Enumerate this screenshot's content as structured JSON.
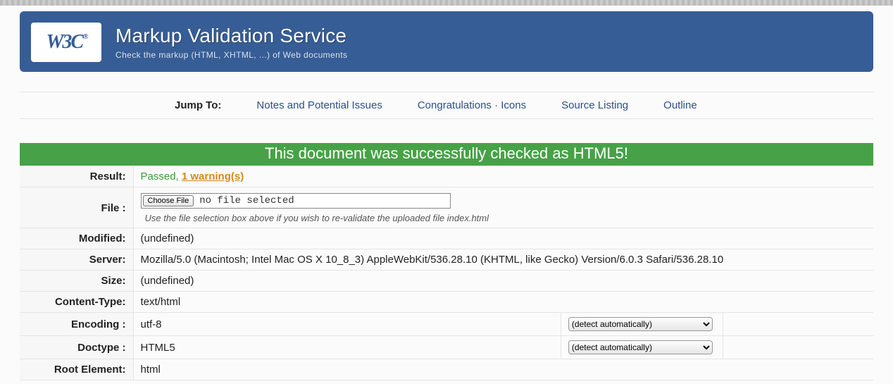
{
  "banner": {
    "logo_text": "W3C",
    "title": "Markup Validation Service",
    "subtitle": "Check the markup (HTML, XHTML, ...) of Web documents"
  },
  "jump": {
    "label": "Jump To:",
    "links": {
      "notes": "Notes and Potential Issues",
      "congrats": "Congratulations · Icons",
      "source": "Source Listing",
      "outline": "Outline"
    }
  },
  "success_banner": "This document was successfully checked as HTML5!",
  "rows": {
    "result_label": "Result:",
    "result_passed": "Passed, ",
    "result_warn": "1 warning(s)",
    "file_label": "File :",
    "file_button": "Choose File",
    "file_nosel": "no file selected",
    "file_help": "Use the file selection box above if you wish to re-validate the uploaded file index.html",
    "modified_label": "Modified:",
    "modified_val": "(undefined)",
    "server_label": "Server:",
    "server_val": "Mozilla/5.0 (Macintosh; Intel Mac OS X 10_8_3) AppleWebKit/536.28.10 (KHTML, like Gecko) Version/6.0.3 Safari/536.28.10",
    "size_label": "Size:",
    "size_val": "(undefined)",
    "ctype_label": "Content-Type:",
    "ctype_val": "text/html",
    "encoding_label": "Encoding :",
    "encoding_val": "utf-8",
    "encoding_sel": "(detect automatically)",
    "doctype_label": "Doctype :",
    "doctype_val": "HTML5",
    "doctype_sel": "(detect automatically)",
    "root_label": "Root Element:",
    "root_val": "html"
  }
}
